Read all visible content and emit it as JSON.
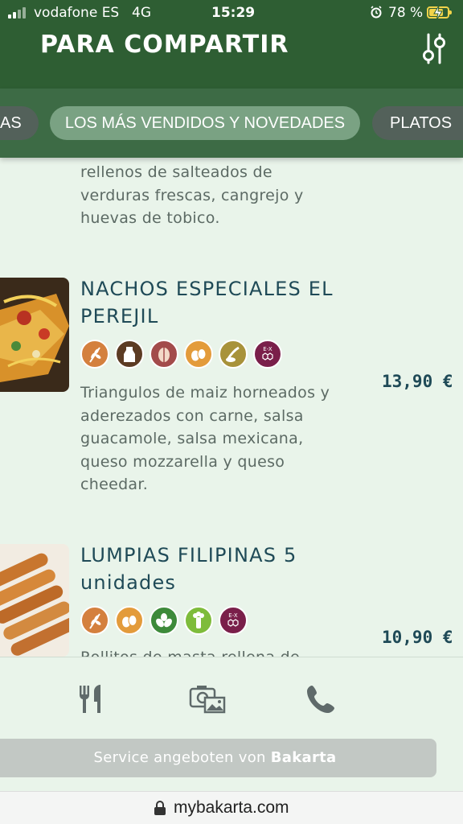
{
  "status_bar": {
    "carrier": "vodafone ES",
    "network": "4G",
    "time": "15:29",
    "battery_percent": "78 %",
    "battery_level": 0.78
  },
  "header": {
    "title": "PARA COMPARTIR",
    "filter_icon": "sliders-icon"
  },
  "tabs": [
    {
      "label": "AS"
    },
    {
      "label": "LOS MÁS VENDIDOS Y NOVEDADES",
      "active": true
    },
    {
      "label": "PLATOS"
    }
  ],
  "items": [
    {
      "description_lines": [
        "rellenos de salteados de",
        "verduras frescas, cangrejo y",
        "huevas de tobico."
      ]
    },
    {
      "title_lines": [
        "NACHOS ESPECIALES EL",
        "PEREJIL"
      ],
      "allergens": [
        "gluten-icon",
        "milk-icon",
        "nuts-icon",
        "eggs-icon",
        "mustard-icon",
        "additives-icon"
      ],
      "price": "13,90 €",
      "description_lines": [
        "Triangulos de maiz horneados y",
        "aderezados con carne, salsa",
        "guacamole, salsa mexicana,",
        "queso mozzarella y queso",
        "cheedar."
      ]
    },
    {
      "title_lines": [
        "LUMPIAS FILIPINAS 5",
        "unidades"
      ],
      "allergens": [
        "gluten-icon",
        "eggs-icon",
        "soy-icon",
        "celery-icon",
        "additives-icon"
      ],
      "price": "10,90 €",
      "description_lines": [
        "Rollitos de masta rellena de"
      ]
    }
  ],
  "bottom_nav": [
    "menu-icon",
    "gallery-icon",
    "phone-icon"
  ],
  "service": {
    "text": "Service angeboten von ",
    "brand": "Bakarta"
  },
  "url": "mybakarta.com",
  "colors": {
    "header": "#2e5e33",
    "tabs_bg": "#3d6b45",
    "active_tab": "#7aa283",
    "background": "#e9f4ea",
    "title_text": "#1f4a57"
  }
}
